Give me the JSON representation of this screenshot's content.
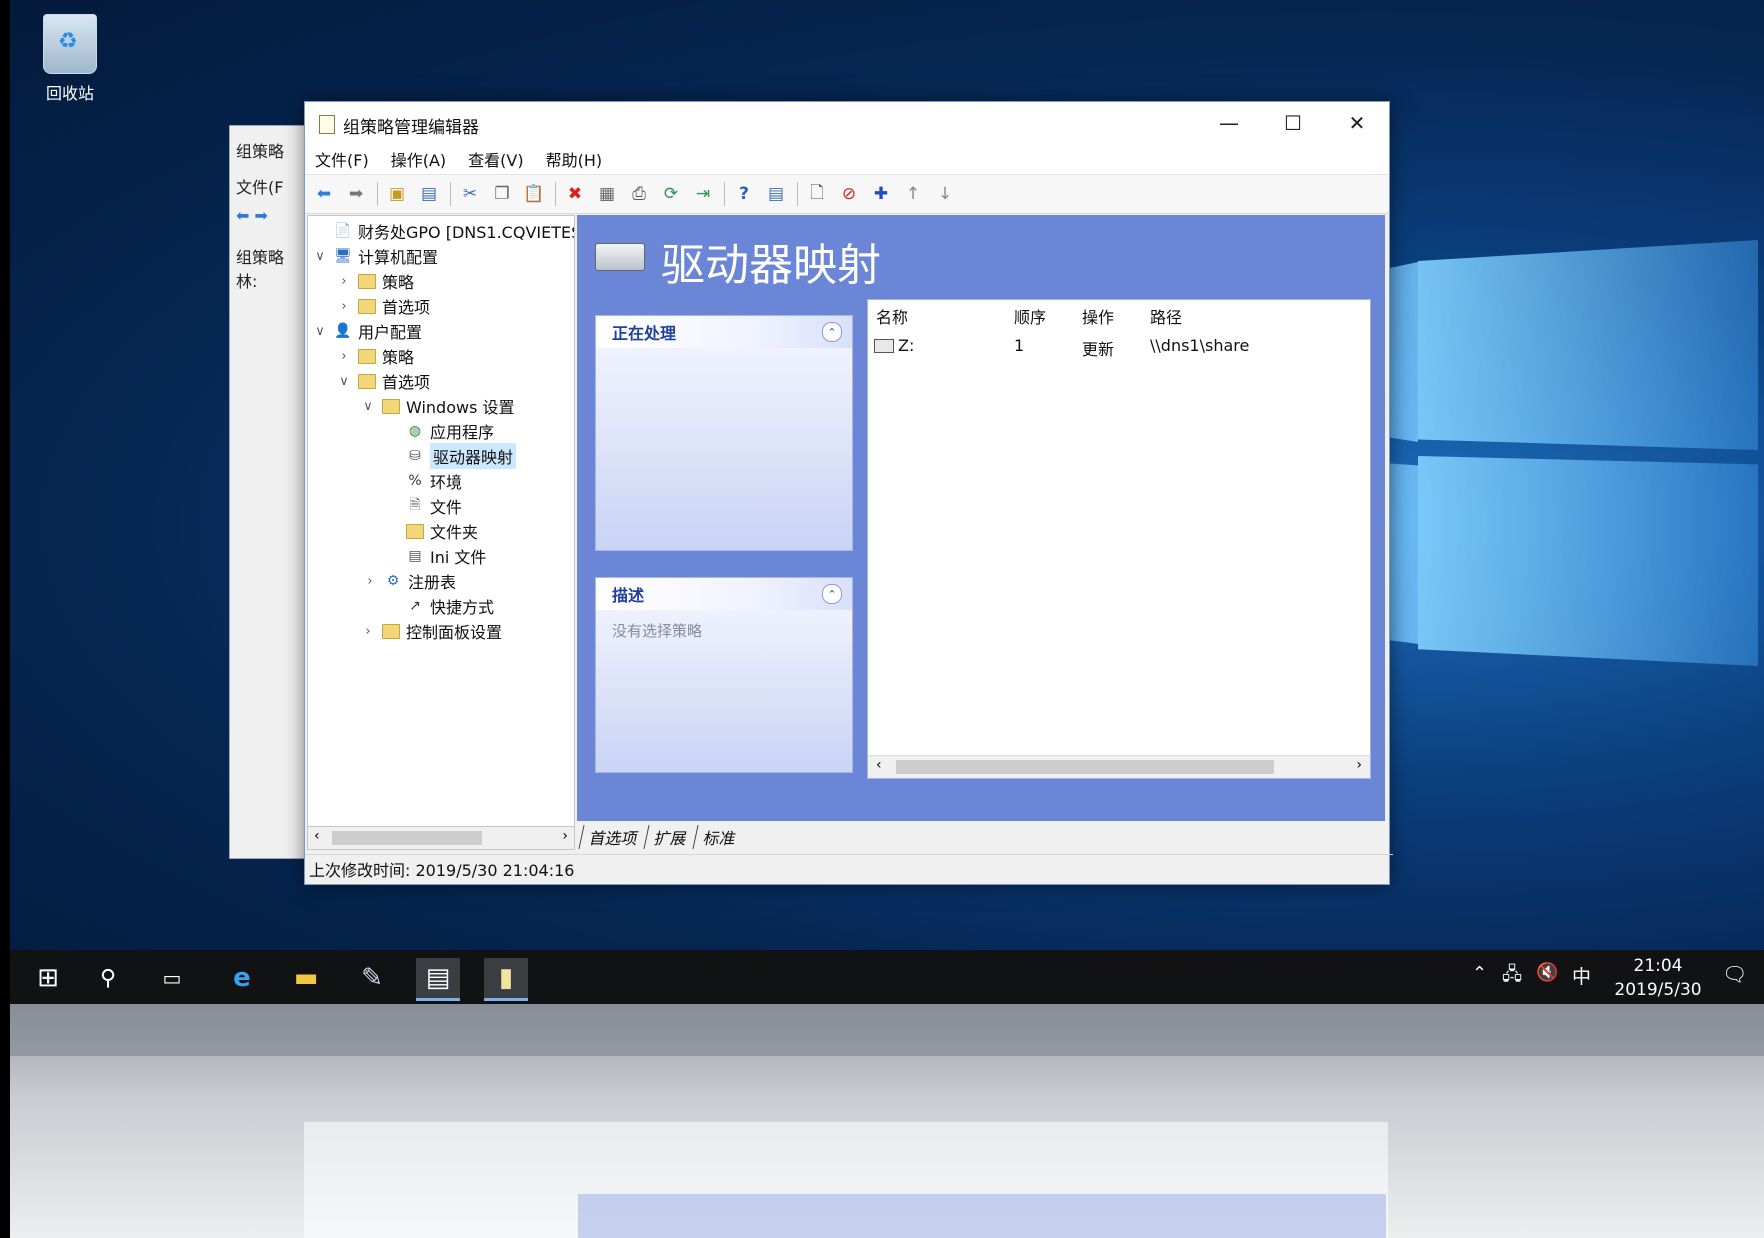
{
  "desktop": {
    "recycle_bin_label": "回收站"
  },
  "back_window": {
    "title": "组策略",
    "menu_file": "文件(F",
    "tree_root": "组策略",
    "tree_forest": "林:"
  },
  "window": {
    "title": "组策略管理编辑器",
    "minimize": "—",
    "maximize": "☐",
    "close": "✕",
    "menu": [
      "文件(F)",
      "操作(A)",
      "查看(V)",
      "帮助(H)"
    ],
    "tree": {
      "root": "财务处GPO [DNS1.CQVIETES",
      "computer_config": "计算机配置",
      "policies": "策略",
      "preferences": "首选项",
      "user_config": "用户配置",
      "user_policies": "策略",
      "user_preferences": "首选项",
      "windows_settings": "Windows 设置",
      "applications": "应用程序",
      "drive_maps": "驱动器映射",
      "environment": "环境",
      "files": "文件",
      "folders": "文件夹",
      "ini_files": "Ini 文件",
      "registry": "注册表",
      "shortcuts": "快捷方式",
      "control_panel": "控制面板设置"
    },
    "heading": "驱动器映射",
    "processing_panel": {
      "title": "正在处理"
    },
    "description_panel": {
      "title": "描述",
      "body": "没有选择策略"
    },
    "list": {
      "columns": [
        "名称",
        "顺序",
        "操作",
        "路径"
      ],
      "rows": [
        {
          "name": "Z:",
          "order": "1",
          "action": "更新",
          "path": "\\\\dns1\\share"
        }
      ]
    },
    "tabs": [
      "首选项",
      "扩展",
      "标准"
    ],
    "status": "上次修改时间: 2019/5/30 21:04:16"
  },
  "taskbar": {
    "time": "21:04",
    "date": "2019/5/30",
    "ime": "中"
  }
}
